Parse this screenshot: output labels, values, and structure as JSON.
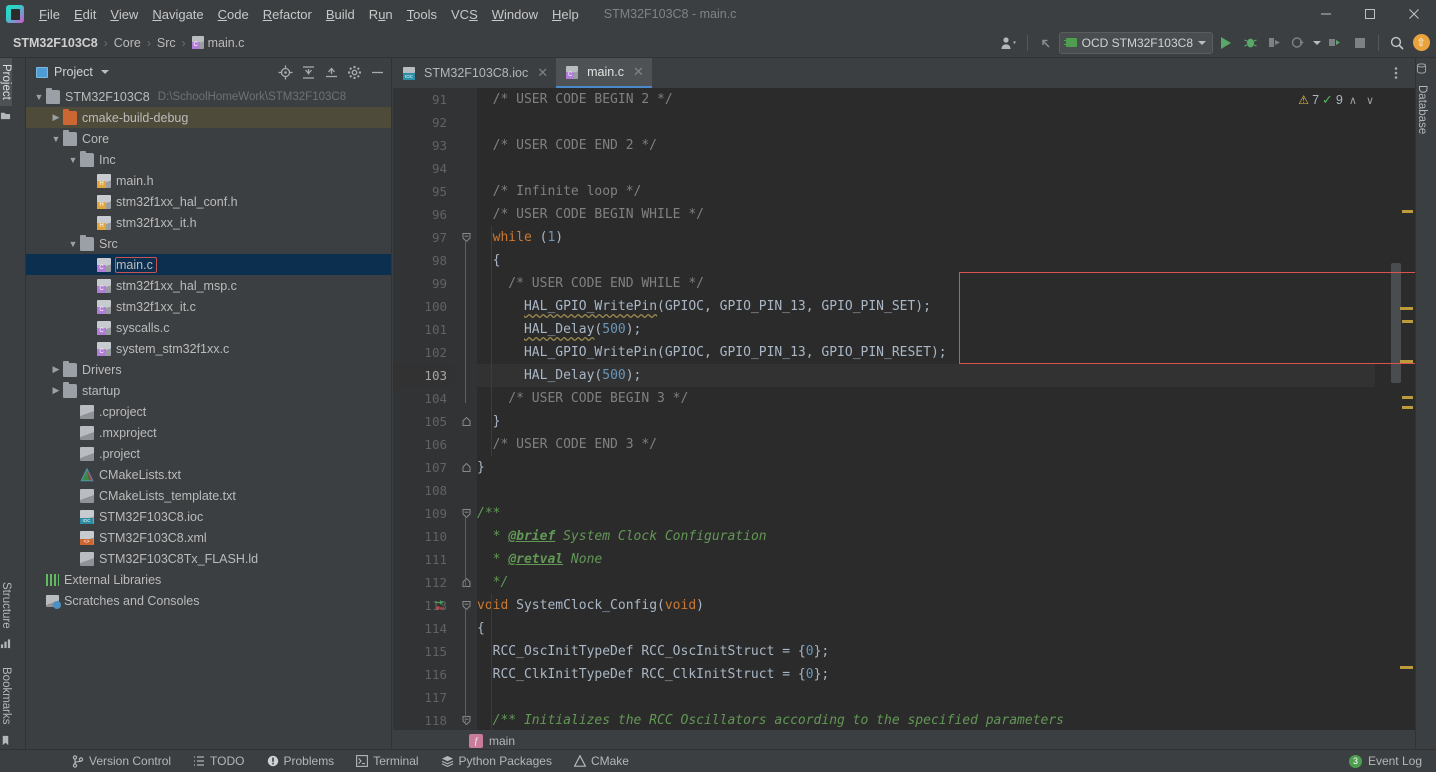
{
  "window": {
    "title": "STM32F103C8 - main.c",
    "minimize_label": "—",
    "maximize_label": "☐",
    "close_label": "✕"
  },
  "menubar": {
    "items": [
      "File",
      "Edit",
      "View",
      "Navigate",
      "Code",
      "Refactor",
      "Build",
      "Run",
      "Tools",
      "VCS",
      "Window",
      "Help"
    ]
  },
  "navbar": {
    "breadcrumbs": [
      "STM32F103C8",
      "Core",
      "Src",
      "main.c"
    ],
    "separator": "›",
    "run_config": "OCD STM32F103C8",
    "icons": [
      "user-dropdown-icon",
      "back-arrow-icon",
      "run-icon",
      "debug-icon",
      "run-with-coverage-icon",
      "profile-icon",
      "attach-icon",
      "stop-icon",
      "search-everywhere-icon",
      "updates-icon"
    ]
  },
  "left_toolwindows": [
    {
      "label": "Project",
      "active": true
    },
    {
      "label": "Structure",
      "active": false
    },
    {
      "label": "Bookmarks",
      "active": false
    }
  ],
  "right_toolwindows": [
    {
      "label": "Database",
      "active": false
    }
  ],
  "project_panel": {
    "title": "Project",
    "tools": [
      "locate-icon",
      "expand-all-icon",
      "collapse-all-icon",
      "settings-gear-icon",
      "hide-icon"
    ],
    "tree": [
      {
        "depth": 0,
        "label": "STM32F103C8",
        "sublabel": "D:\\SchoolHomeWork\\STM32F103C8",
        "arrow": "down",
        "icon": "folder-icon",
        "state": "normal"
      },
      {
        "depth": 1,
        "label": "cmake-build-debug",
        "sublabel": "",
        "arrow": "right",
        "icon": "folder-orange-icon",
        "state": "modified"
      },
      {
        "depth": 1,
        "label": "Core",
        "sublabel": "",
        "arrow": "down",
        "icon": "folder-icon",
        "state": "normal"
      },
      {
        "depth": 2,
        "label": "Inc",
        "sublabel": "",
        "arrow": "down",
        "icon": "folder-icon",
        "state": "normal"
      },
      {
        "depth": 3,
        "label": "main.h",
        "sublabel": "",
        "arrow": "",
        "icon": "h-file-icon",
        "state": "normal"
      },
      {
        "depth": 3,
        "label": "stm32f1xx_hal_conf.h",
        "sublabel": "",
        "arrow": "",
        "icon": "h-file-icon",
        "state": "normal"
      },
      {
        "depth": 3,
        "label": "stm32f1xx_it.h",
        "sublabel": "",
        "arrow": "",
        "icon": "h-file-icon",
        "state": "normal"
      },
      {
        "depth": 2,
        "label": "Src",
        "sublabel": "",
        "arrow": "down",
        "icon": "folder-icon",
        "state": "normal"
      },
      {
        "depth": 3,
        "label": "main.c",
        "sublabel": "",
        "arrow": "",
        "icon": "c-file-icon",
        "state": "selected"
      },
      {
        "depth": 3,
        "label": "stm32f1xx_hal_msp.c",
        "sublabel": "",
        "arrow": "",
        "icon": "c-file-icon",
        "state": "normal"
      },
      {
        "depth": 3,
        "label": "stm32f1xx_it.c",
        "sublabel": "",
        "arrow": "",
        "icon": "c-file-icon",
        "state": "normal"
      },
      {
        "depth": 3,
        "label": "syscalls.c",
        "sublabel": "",
        "arrow": "",
        "icon": "c-file-icon",
        "state": "normal"
      },
      {
        "depth": 3,
        "label": "system_stm32f1xx.c",
        "sublabel": "",
        "arrow": "",
        "icon": "c-file-icon",
        "state": "normal"
      },
      {
        "depth": 1,
        "label": "Drivers",
        "sublabel": "",
        "arrow": "right",
        "icon": "folder-icon",
        "state": "normal"
      },
      {
        "depth": 1,
        "label": "startup",
        "sublabel": "",
        "arrow": "right",
        "icon": "folder-icon",
        "state": "normal"
      },
      {
        "depth": 2,
        "label": ".cproject",
        "sublabel": "",
        "arrow": "",
        "icon": "doc-file-icon",
        "state": "normal"
      },
      {
        "depth": 2,
        "label": ".mxproject",
        "sublabel": "",
        "arrow": "",
        "icon": "doc-file-icon",
        "state": "normal"
      },
      {
        "depth": 2,
        "label": ".project",
        "sublabel": "",
        "arrow": "",
        "icon": "doc-file-icon",
        "state": "normal"
      },
      {
        "depth": 2,
        "label": "CMakeLists.txt",
        "sublabel": "",
        "arrow": "",
        "icon": "cmake-file-icon",
        "state": "normal"
      },
      {
        "depth": 2,
        "label": "CMakeLists_template.txt",
        "sublabel": "",
        "arrow": "",
        "icon": "doc-file-icon",
        "state": "normal"
      },
      {
        "depth": 2,
        "label": "STM32F103C8.ioc",
        "sublabel": "",
        "arrow": "",
        "icon": "ioc-file-icon",
        "state": "normal"
      },
      {
        "depth": 2,
        "label": "STM32F103C8.xml",
        "sublabel": "",
        "arrow": "",
        "icon": "xml-file-icon",
        "state": "normal"
      },
      {
        "depth": 2,
        "label": "STM32F103C8Tx_FLASH.ld",
        "sublabel": "",
        "arrow": "",
        "icon": "doc-file-icon",
        "state": "normal"
      },
      {
        "depth": 0,
        "label": "External Libraries",
        "sublabel": "",
        "arrow": "",
        "icon": "library-icon",
        "state": "normal"
      },
      {
        "depth": 0,
        "label": "Scratches and Consoles",
        "sublabel": "",
        "arrow": "",
        "icon": "scratches-icon",
        "state": "normal"
      }
    ]
  },
  "editor": {
    "tabs": [
      {
        "label": "STM32F103C8.ioc",
        "icon": "ioc-file-icon",
        "active": false,
        "close": "✕"
      },
      {
        "label": "main.c",
        "icon": "c-file-icon",
        "active": true,
        "close": "✕"
      }
    ],
    "inspection": {
      "warning_count": "7",
      "ok_count": "9",
      "prev_label": "∧",
      "next_label": "∨"
    },
    "current_line": 103,
    "first_line": 91,
    "lines": [
      {
        "n": 91,
        "text": "  /* USER CODE BEGIN 2 */"
      },
      {
        "n": 92,
        "text": ""
      },
      {
        "n": 93,
        "text": "  /* USER CODE END 2 */"
      },
      {
        "n": 94,
        "text": ""
      },
      {
        "n": 95,
        "text": "  /* Infinite loop */"
      },
      {
        "n": 96,
        "text": "  /* USER CODE BEGIN WHILE */"
      },
      {
        "n": 97,
        "text": "  while (1)"
      },
      {
        "n": 98,
        "text": "  {"
      },
      {
        "n": 99,
        "text": "    /* USER CODE END WHILE */"
      },
      {
        "n": 100,
        "text": "      HAL_GPIO_WritePin(GPIOC, GPIO_PIN_13, GPIO_PIN_SET);"
      },
      {
        "n": 101,
        "text": "      HAL_Delay(500);"
      },
      {
        "n": 102,
        "text": "      HAL_GPIO_WritePin(GPIOC, GPIO_PIN_13, GPIO_PIN_RESET);"
      },
      {
        "n": 103,
        "text": "      HAL_Delay(500);"
      },
      {
        "n": 104,
        "text": "    /* USER CODE BEGIN 3 */"
      },
      {
        "n": 105,
        "text": "  }"
      },
      {
        "n": 106,
        "text": "  /* USER CODE END 3 */"
      },
      {
        "n": 107,
        "text": "}"
      },
      {
        "n": 108,
        "text": ""
      },
      {
        "n": 109,
        "text": "/**"
      },
      {
        "n": 110,
        "text": "  * @brief System Clock Configuration"
      },
      {
        "n": 111,
        "text": "  * @retval None"
      },
      {
        "n": 112,
        "text": "  */"
      },
      {
        "n": 113,
        "text": "void SystemClock_Config(void)"
      },
      {
        "n": 114,
        "text": "{"
      },
      {
        "n": 115,
        "text": "  RCC_OscInitTypeDef RCC_OscInitStruct = {0};"
      },
      {
        "n": 116,
        "text": "  RCC_ClkInitTypeDef RCC_ClkInitStruct = {0};"
      },
      {
        "n": 117,
        "text": ""
      },
      {
        "n": 118,
        "text": "  /** Initializes the RCC Oscillators according to the specified parameters"
      }
    ],
    "breadcrumb": {
      "label": "main",
      "icon": "function-icon"
    }
  },
  "statusbar": {
    "items": [
      {
        "label": "Version Control",
        "icon": "branch-icon"
      },
      {
        "label": "TODO",
        "icon": "list-icon"
      },
      {
        "label": "Problems",
        "icon": "warning-circle-icon"
      },
      {
        "label": "Terminal",
        "icon": "terminal-icon"
      },
      {
        "label": "Python Packages",
        "icon": "python-icon"
      },
      {
        "label": "CMake",
        "icon": "cmake-icon"
      }
    ],
    "event_log": {
      "label": "Event Log",
      "count": "3"
    }
  },
  "colors": {
    "panel_bg": "#3c3f41",
    "editor_bg": "#2b2b2b",
    "gutter_bg": "#313335",
    "selection_blue": "#0d2f4f",
    "accent_red": "#d9534f",
    "keyword_orange": "#cc7832",
    "comment_gray": "#808080",
    "doc_green": "#629755",
    "number_blue": "#6897bb",
    "text_default": "#a9b7c6",
    "run_green": "#59a869",
    "marker_yellow": "#bb9b3a",
    "warning_yellow": "#e8bf4e"
  }
}
